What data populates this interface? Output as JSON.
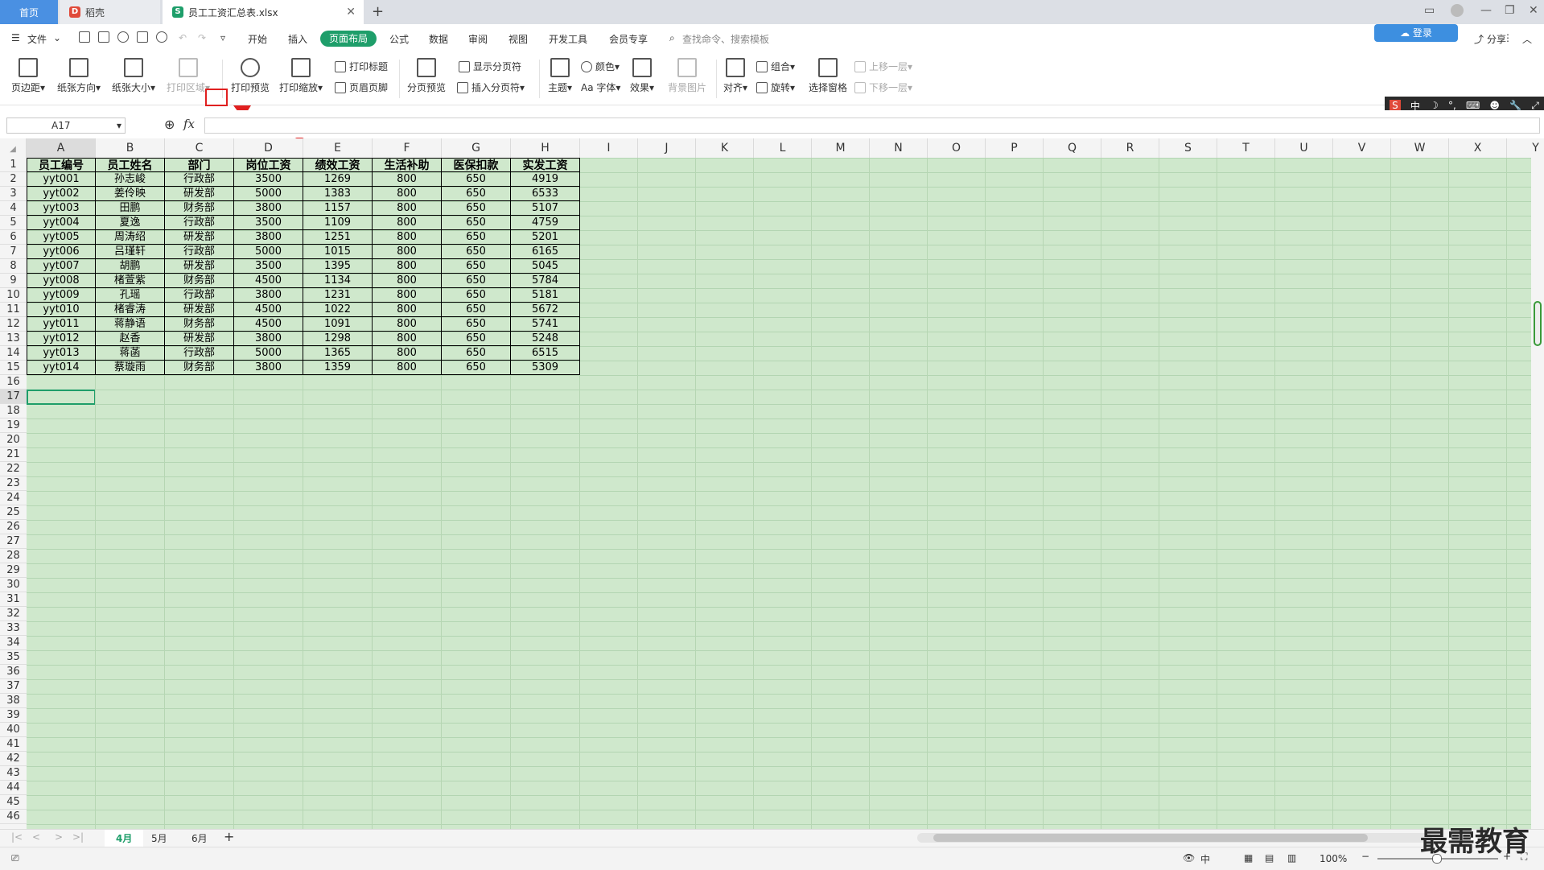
{
  "titlebar": {
    "tabs": [
      {
        "label": "首页"
      },
      {
        "label": "稻壳"
      },
      {
        "label": "员工工资汇总表.xlsx"
      }
    ],
    "close_glyph": "✕",
    "new_tab_glyph": "+"
  },
  "menubar": {
    "file_label": "文件",
    "items": [
      "开始",
      "插入",
      "页面布局",
      "公式",
      "数据",
      "审阅",
      "视图",
      "开发工具",
      "会员专享"
    ],
    "active_item": "页面布局",
    "search_placeholder": "查找命令、搜索模板",
    "right_items": [
      "分享"
    ],
    "login_hint": "登录"
  },
  "ribbon": {
    "big_buttons": [
      "页边距",
      "纸张方向",
      "纸张大小",
      "打印区域",
      "打印预览",
      "打印缩放",
      "分页预览",
      "主题",
      "效果",
      "背景图片",
      "对齐",
      "选择窗格"
    ],
    "small_buttons": [
      "打印标题",
      "页眉页脚",
      "显示分页符",
      "插入分页符",
      "颜色",
      "Aa 字体",
      "组合",
      "旋转",
      "上移一层",
      "下移一层"
    ]
  },
  "formula": {
    "cell_ref": "A17",
    "fx": "fx",
    "content": ""
  },
  "ime": {
    "label": "中"
  },
  "columns": [
    "A",
    "B",
    "C",
    "D",
    "E",
    "F",
    "G",
    "H",
    "I",
    "J",
    "K",
    "L",
    "M",
    "N",
    "O",
    "P",
    "Q",
    "R",
    "S",
    "T",
    "U",
    "V",
    "W",
    "X",
    "Y"
  ],
  "rows": [
    "1",
    "2",
    "3",
    "4",
    "5",
    "6",
    "7",
    "8",
    "9",
    "10",
    "11",
    "12",
    "13",
    "14",
    "15",
    "16",
    "17",
    "18",
    "19",
    "20",
    "21",
    "22",
    "23",
    "24",
    "25",
    "26",
    "27",
    "28",
    "29",
    "30",
    "31",
    "32",
    "33",
    "34",
    "35",
    "36",
    "37",
    "38",
    "39",
    "40",
    "41",
    "42",
    "43",
    "44",
    "45",
    "46"
  ],
  "table": {
    "headers": [
      "员工编号",
      "员工姓名",
      "部门",
      "岗位工资",
      "绩效工资",
      "生活补助",
      "医保扣款",
      "实发工资"
    ],
    "rows": [
      [
        "yyt001",
        "孙志峻",
        "行政部",
        "3500",
        "1269",
        "800",
        "650",
        "4919"
      ],
      [
        "yyt002",
        "姜伶映",
        "研发部",
        "5000",
        "1383",
        "800",
        "650",
        "6533"
      ],
      [
        "yyt003",
        "田鹏",
        "财务部",
        "3800",
        "1157",
        "800",
        "650",
        "5107"
      ],
      [
        "yyt004",
        "夏逸",
        "行政部",
        "3500",
        "1109",
        "800",
        "650",
        "4759"
      ],
      [
        "yyt005",
        "周涛绍",
        "研发部",
        "3800",
        "1251",
        "800",
        "650",
        "5201"
      ],
      [
        "yyt006",
        "吕瑾轩",
        "行政部",
        "5000",
        "1015",
        "800",
        "650",
        "6165"
      ],
      [
        "yyt007",
        "胡鹏",
        "研发部",
        "3500",
        "1395",
        "800",
        "650",
        "5045"
      ],
      [
        "yyt008",
        "楮萱紫",
        "财务部",
        "4500",
        "1134",
        "800",
        "650",
        "5784"
      ],
      [
        "yyt009",
        "孔瑶",
        "行政部",
        "3800",
        "1231",
        "800",
        "650",
        "5181"
      ],
      [
        "yyt010",
        "楮睿涛",
        "研发部",
        "4500",
        "1022",
        "800",
        "650",
        "5672"
      ],
      [
        "yyt011",
        "蒋静语",
        "财务部",
        "4500",
        "1091",
        "800",
        "650",
        "5741"
      ],
      [
        "yyt012",
        "赵香",
        "研发部",
        "3800",
        "1298",
        "800",
        "650",
        "5248"
      ],
      [
        "yyt013",
        "蒋菡",
        "行政部",
        "5000",
        "1365",
        "800",
        "650",
        "6515"
      ],
      [
        "yyt014",
        "蔡璇雨",
        "财务部",
        "3800",
        "1359",
        "800",
        "650",
        "5309"
      ]
    ]
  },
  "sheets": {
    "tabs": [
      "4月",
      "5月",
      "6月"
    ],
    "active": "4月",
    "add": "+"
  },
  "status": {
    "zoom": "100%"
  },
  "watermark": "最需教育",
  "colors": {
    "accent": "#1e9e6a",
    "sheet_bg": "#cfe8cc",
    "home_tab": "#4a90e2",
    "highlight": "#e02020"
  }
}
